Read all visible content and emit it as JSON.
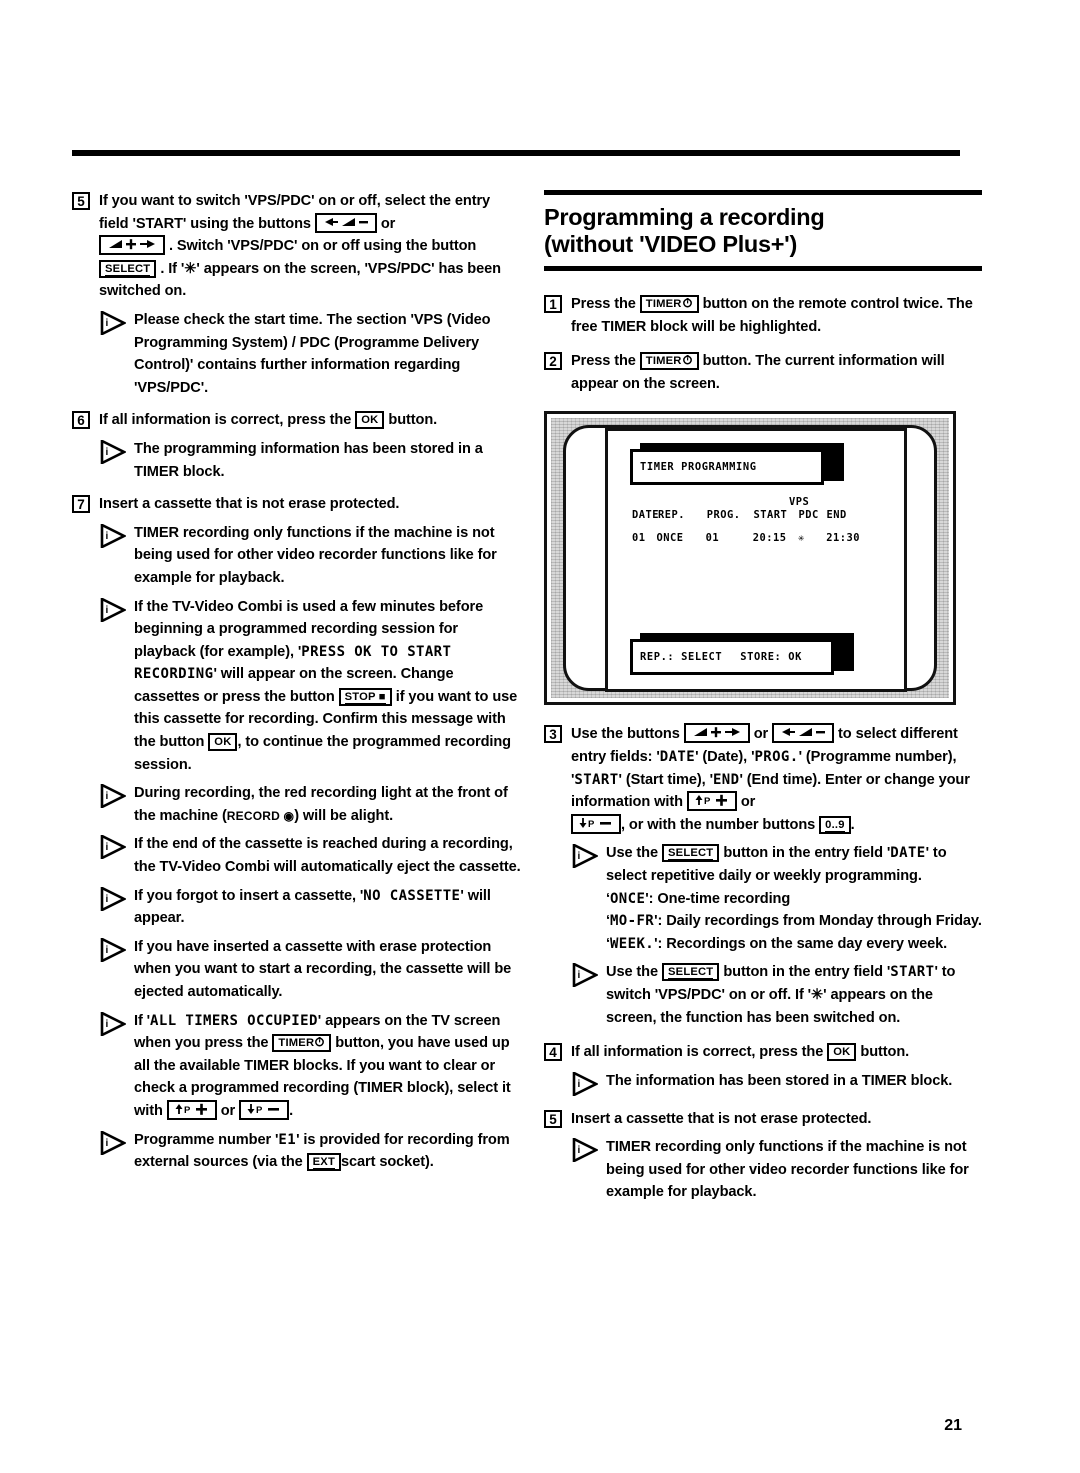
{
  "page": {
    "number": "21",
    "top_rule": true
  },
  "left_column": {
    "step5": {
      "num": "5",
      "t1": "If you want to switch 'VPS/PDC' on or off, select the entry field 'START' using the buttons",
      "key_vol_down": "← ◢ −",
      "t2": "or",
      "key_vol_up": "◢ + →",
      "t3": ". Switch 'VPS/PDC' on or off using the button",
      "key_select": "SELECT",
      "t4": ". If '✳' appears on the screen, 'VPS/PDC' has been switched on."
    },
    "note5": "Please check the start time. The section 'VPS (Video Programming System) / PDC (Programme Delivery Control)' contains further information regarding 'VPS/PDC'.",
    "step6": {
      "num": "6",
      "t1": "If all information is correct, press the",
      "key_ok": "OK",
      "t2": "button."
    },
    "note6": "The programming information has been stored in a TIMER block.",
    "step7": {
      "num": "7",
      "t1": "Insert a cassette that is not erase protected."
    },
    "note7a": "TIMER recording only functions if the machine is not being used for other video recorder functions like for example for playback.",
    "note7b": {
      "t1": "If the TV-Video Combi is used a few minutes before beginning a programmed recording session for playback (for example), '",
      "mono1": "PRESS OK TO START RECORDING",
      "t2": "' will appear on the screen. Change cassettes or press the button",
      "key_stop": "STOP ■",
      "t3": "if you want to use this cassette for recording. Confirm this message with the button",
      "key_ok": "OK",
      "t4": ", to continue the programmed recording session."
    },
    "note7c": {
      "t1": "During recording, the red recording light at the front of the machine (",
      "key_record": "RECORD ◉",
      "t2": ") will be alight."
    },
    "note7d": "If the end of the cassette is reached during a recording, the TV-Video Combi will automatically eject the cassette.",
    "note7e": {
      "t1": "If you forgot to insert a cassette, '",
      "mono1": "NO CASSETTE",
      "t2": "' will appear."
    },
    "note7f": "If you have inserted a cassette with erase protection when you want to start a recording, the cassette will be ejected automatically.",
    "note7g": {
      "t1": "If '",
      "mono1": "ALL TIMERS OCCUPIED",
      "t2": "' appears on the TV screen when you press the",
      "key_timer": "TIMER",
      "t3": "button, you have used up all the available TIMER blocks. If you want to clear or check a programmed recording (TIMER block), select it with",
      "key_pplus": "↑P +",
      "t4": "or",
      "key_pminus": "↓P −",
      "t5": "."
    },
    "note7h": {
      "t1": "Programme number '",
      "mono1": "E1",
      "t2": "' is provided for recording from external sources (via the",
      "key_ext": "EXT",
      "t3": "scart socket)."
    }
  },
  "right_column": {
    "heading_line1": "Programming a recording",
    "heading_line2": "(without 'VIDEO Plus+')",
    "step1": {
      "num": "1",
      "t1": "Press the",
      "key_timer": "TIMER",
      "t2": "button on the remote control",
      "bold": "twice",
      "t3": ". The free TIMER block will be highlighted."
    },
    "step2": {
      "num": "2",
      "t1": "Press the",
      "key_timer": "TIMER",
      "t2": "button. The current information will appear on the screen."
    },
    "tv_screen": {
      "osd_title": "TIMER PROGRAMMING",
      "vps_label": "VPS",
      "headers": [
        "DATE",
        "REP.",
        "PROG.",
        "START",
        "PDC",
        "END"
      ],
      "row": [
        "01",
        "ONCE",
        "01",
        "20:15",
        "✳",
        "21:30"
      ],
      "footer_left": "REP.: SELECT",
      "footer_right": "STORE: OK"
    },
    "step3": {
      "num": "3",
      "t1": "Use the buttons",
      "key_vol_up": "◢ + →",
      "t2": "or",
      "key_vol_down": "← ◢ −",
      "t3": "to select different entry fields: '",
      "mono_date": "DATE",
      "t4": "' (Date), '",
      "mono_prog": "PROG.",
      "t5": "' (Programme number), '",
      "mono_start": "START",
      "t6": "' (Start time), '",
      "mono_end": "END",
      "t7": "' (End time). Enter or change your information with",
      "key_pplus": "↑P +",
      "t8": "or",
      "key_pminus": "↓P −",
      "t9": ", or with the number buttons",
      "key_numbers": "0..9",
      "t10": "."
    },
    "note3a": {
      "t1": "Use the",
      "key_select": "SELECT",
      "t2": "button in the entry field '",
      "mono_date": "DATE",
      "t3": "' to select repetitive daily or weekly programming.",
      "l1_mono": "ONCE",
      "l1_txt": "': One-time recording",
      "l2_mono": "MO-FR",
      "l2_txt": "': Daily recordings from Monday through Friday.",
      "l3_mono": "WEEK.",
      "l3_txt": "': Recordings on the same day every week."
    },
    "note3b": {
      "t1": "Use the",
      "key_select": "SELECT",
      "t2": "button in the entry field '",
      "mono_start": "START",
      "t3": "' to switch 'VPS/PDC' on or off. If '✳' appears on the screen, the function has been switched on."
    },
    "step4": {
      "num": "4",
      "t1": "If all information is correct, press the",
      "key_ok": "OK",
      "t2": "button."
    },
    "note4": "The information has been stored in a TIMER block.",
    "step5": {
      "num": "5",
      "t1": "Insert a cassette that is not erase protected."
    },
    "note5": "TIMER recording only functions if the machine is not being used for other video recorder functions like for example for playback."
  },
  "colors": {
    "ink": "#000000",
    "paper": "#ffffff",
    "tv_frame": "#d8d8d8"
  }
}
